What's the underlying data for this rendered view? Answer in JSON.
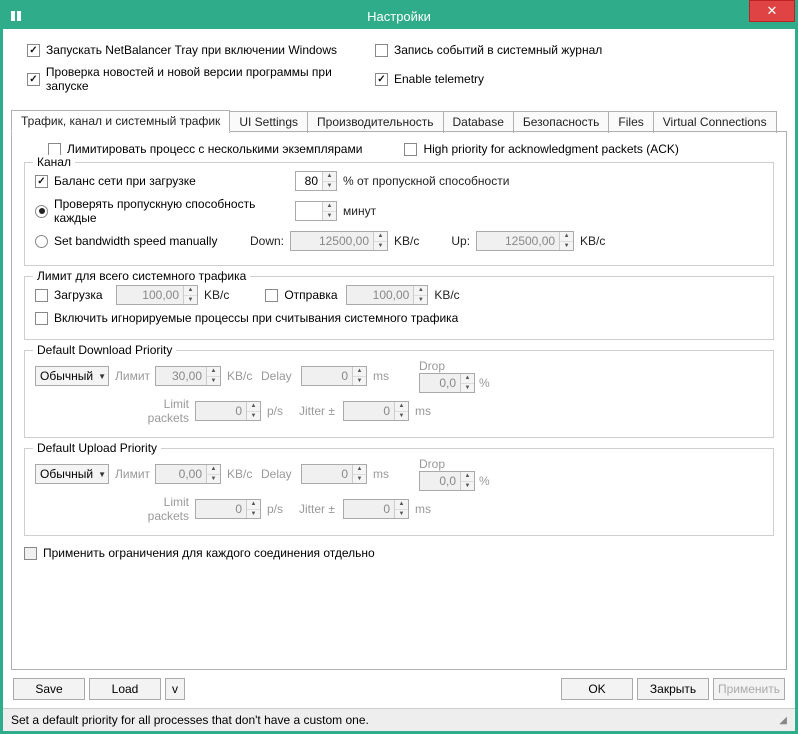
{
  "title": "Настройки",
  "top": {
    "run_tray": "Запускать NetBalancer Tray при включении Windows",
    "log_events": "Запись событий в системный журнал",
    "check_news": "Проверка новостей и новой версии программы при запуске",
    "telemetry": "Enable telemetry"
  },
  "tabs": [
    "Трафик, канал и системный трафик",
    "UI Settings",
    "Производительность",
    "Database",
    "Безопасность",
    "Files",
    "Virtual Connections"
  ],
  "main": {
    "limit_multi": "Лимитировать процесс с несколькими экземплярами",
    "high_prio_ack": "High priority for acknowledgment packets (ACK)"
  },
  "channel": {
    "legend": "Канал",
    "balance": "Баланс сети при загрузке",
    "balance_val": "80",
    "balance_unit": "% от пропускной способности",
    "check_bw": "Проверять пропускную способность каждые",
    "check_bw_unit": "минут",
    "manual": "Set bandwidth speed manually",
    "down_lbl": "Down:",
    "down_val": "12500,00",
    "up_lbl": "Up:",
    "up_val": "12500,00",
    "kbc": "KB/c"
  },
  "syslimit": {
    "legend": "Лимит для всего системного трафика",
    "download": "Загрузка",
    "download_val": "100,00",
    "upload": "Отправка",
    "upload_val": "100,00",
    "kbc": "KB/c",
    "include_ignored": "Включить игнорируемые процессы при считывания системного трафика"
  },
  "ddp": {
    "legend": "Default Download Priority",
    "combo": "Обычный",
    "limit_lbl": "Лимит",
    "limit_val": "30,00",
    "kbc": "KB/c",
    "delay_lbl": "Delay",
    "delay_val": "0",
    "ms": "ms",
    "drop_lbl": "Drop",
    "drop_val": "0,0",
    "pct": "%",
    "limit_packets_lbl": "Limit packets",
    "limit_packets_val": "0",
    "ps": "p/s",
    "jitter_lbl": "Jitter ±",
    "jitter_val": "0"
  },
  "dup": {
    "legend": "Default Upload Priority",
    "combo": "Обычный",
    "limit_lbl": "Лимит",
    "limit_val": "0,00",
    "kbc": "KB/c",
    "delay_lbl": "Delay",
    "delay_val": "0",
    "ms": "ms",
    "drop_lbl": "Drop",
    "drop_val": "0,0",
    "pct": "%",
    "limit_packets_lbl": "Limit packets",
    "limit_packets_val": "0",
    "ps": "p/s",
    "jitter_lbl": "Jitter ±",
    "jitter_val": "0"
  },
  "per_conn": "Применить ограничения для каждого соединения отдельно",
  "buttons": {
    "save": "Save",
    "load": "Load",
    "v": "v",
    "ok": "OK",
    "close": "Закрыть",
    "apply": "Применить"
  },
  "status": "Set a default priority for all processes that don't have a custom one."
}
